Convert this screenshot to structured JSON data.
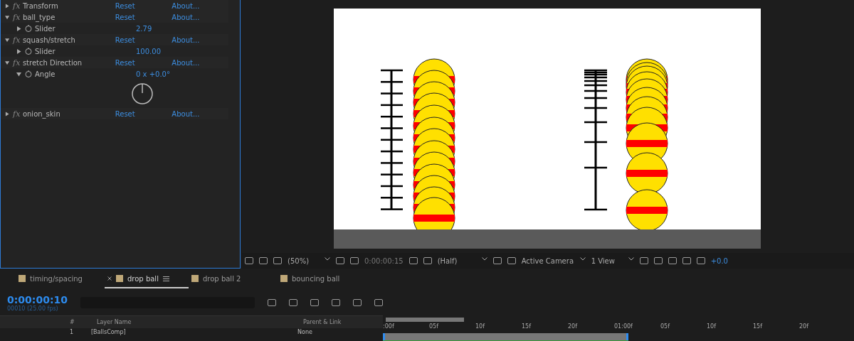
{
  "effects": [
    {
      "name": "Transform",
      "badge": "fx",
      "expanded": false,
      "reset": "Reset",
      "about": "About..."
    },
    {
      "name": "ball_type",
      "badge": "fx",
      "expanded": true,
      "reset": "Reset",
      "about": "About...",
      "props": [
        {
          "kind": "slider",
          "name": "Slider",
          "value": "2.79"
        }
      ]
    },
    {
      "name": "squash/stretch",
      "badge": "fx",
      "expanded": true,
      "reset": "Reset",
      "about": "About...",
      "props": [
        {
          "kind": "slider",
          "name": "Slider",
          "value": "100.00"
        }
      ]
    },
    {
      "name": "stretch Direction",
      "badge": "fx",
      "expanded": true,
      "reset": "Reset",
      "about": "About...",
      "props": [
        {
          "kind": "angle",
          "name": "Angle",
          "value": "0 x +0.0°"
        }
      ]
    },
    {
      "name": "onion_skin",
      "badge": "fx",
      "expanded": false,
      "reset": "Reset",
      "about": "About..."
    }
  ],
  "viewer_toolbar": {
    "zoom": "(50%)",
    "timecode": "0:00:00:15",
    "resolution": "(Half)",
    "camera": "Active Camera",
    "views": "1 View",
    "exposure": "+0.0"
  },
  "tabs": [
    {
      "label": "timing/spacing",
      "selected": false
    },
    {
      "label": "drop ball",
      "selected": true
    },
    {
      "label": "drop ball 2",
      "selected": false
    },
    {
      "label": "bouncing ball",
      "selected": false
    }
  ],
  "timeline": {
    "timecode": "0:00:00:10",
    "frame_info": "00010 (25.00 fps)",
    "columns": [
      "#",
      "Layer Name",
      "Parent & Link"
    ],
    "layers": [
      {
        "number": "1",
        "name": "[BallsComp]",
        "parent": "None"
      }
    ],
    "ruler": [
      ":00f",
      "05f",
      "10f",
      "15f",
      "20f",
      "01:00f",
      "05f",
      "10f",
      "15f",
      "20f"
    ]
  }
}
